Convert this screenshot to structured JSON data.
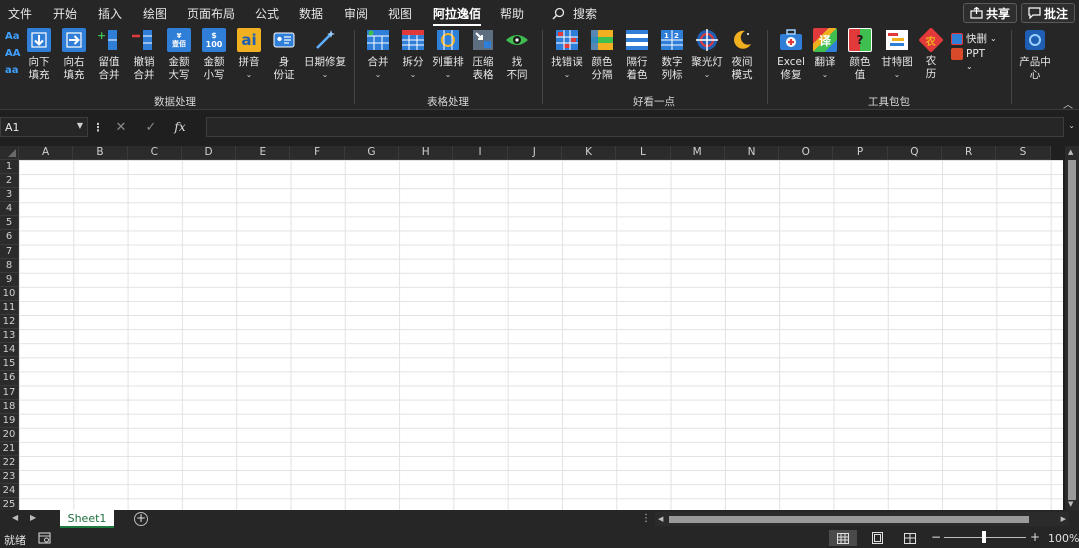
{
  "menu": {
    "tabs": [
      "文件",
      "开始",
      "插入",
      "绘图",
      "页面布局",
      "公式",
      "数据",
      "审阅",
      "视图",
      "阿拉逸佰",
      "帮助"
    ],
    "active_tab": "阿拉逸佰",
    "search_label": "搜索",
    "share_label": "共享",
    "comments_label": "批注"
  },
  "ribbon": {
    "case_buttons": [
      "Aa",
      "AA",
      "aa"
    ],
    "groups": {
      "data_processing": "数据处理",
      "table_processing": "表格处理",
      "looks_better": "好看一点",
      "toolkit": "工具包包"
    },
    "buttons": {
      "fill_down": "向下\n填充",
      "fill_right": "向右\n填充",
      "keep_merge": "留值\n合并",
      "undo_merge": "撤销\n合并",
      "amount_upper": "金额\n大写",
      "amount_lower": "金额\n小写",
      "pinyin": "拼音",
      "id_card": "身\n份证",
      "date_fix": "日期修复",
      "merge": "合并",
      "split": "拆分",
      "col_rearrange": "列重排",
      "compress_table": "压缩\n表格",
      "find_diff": "找\n不同",
      "find_error": "找错误",
      "color_sep": "颜色\n分隔",
      "alt_row_color": "隔行\n着色",
      "num_col": "数字\n列标",
      "spotlight": "聚光灯",
      "night_mode": "夜间\n模式",
      "excel_repair": "Excel\n修复",
      "translate": "翻译",
      "color_value": "颜色\n值",
      "gantt": "甘特图",
      "lunar": "农\n历",
      "quick_delete": "快删",
      "ppt": "PPT",
      "product_center": "产品中\n心"
    },
    "icon_texts": {
      "amount_upper": "¥\n壹佰",
      "amount_lower": "$\n100",
      "pinyin": "ai",
      "translate": "译",
      "color_value": "?",
      "lunar": "农"
    }
  },
  "formula_bar": {
    "name_box": "A1",
    "fx_label": "fx",
    "value": ""
  },
  "grid": {
    "columns": [
      "A",
      "B",
      "C",
      "D",
      "E",
      "F",
      "G",
      "H",
      "I",
      "J",
      "K",
      "L",
      "M",
      "N",
      "O",
      "P",
      "Q",
      "R",
      "S"
    ],
    "rows": [
      "1",
      "2",
      "3",
      "4",
      "5",
      "6",
      "7",
      "8",
      "9",
      "10",
      "11",
      "12",
      "13",
      "14",
      "15",
      "16",
      "17",
      "18",
      "19",
      "20",
      "21",
      "22",
      "23",
      "24",
      "25"
    ]
  },
  "sheets": {
    "tabs": [
      "Sheet1"
    ],
    "active": "Sheet1",
    "add_label": "+"
  },
  "status": {
    "ready_text": "就绪",
    "zoom_minus": "−",
    "zoom_plus": "+",
    "zoom_level": "100%"
  }
}
